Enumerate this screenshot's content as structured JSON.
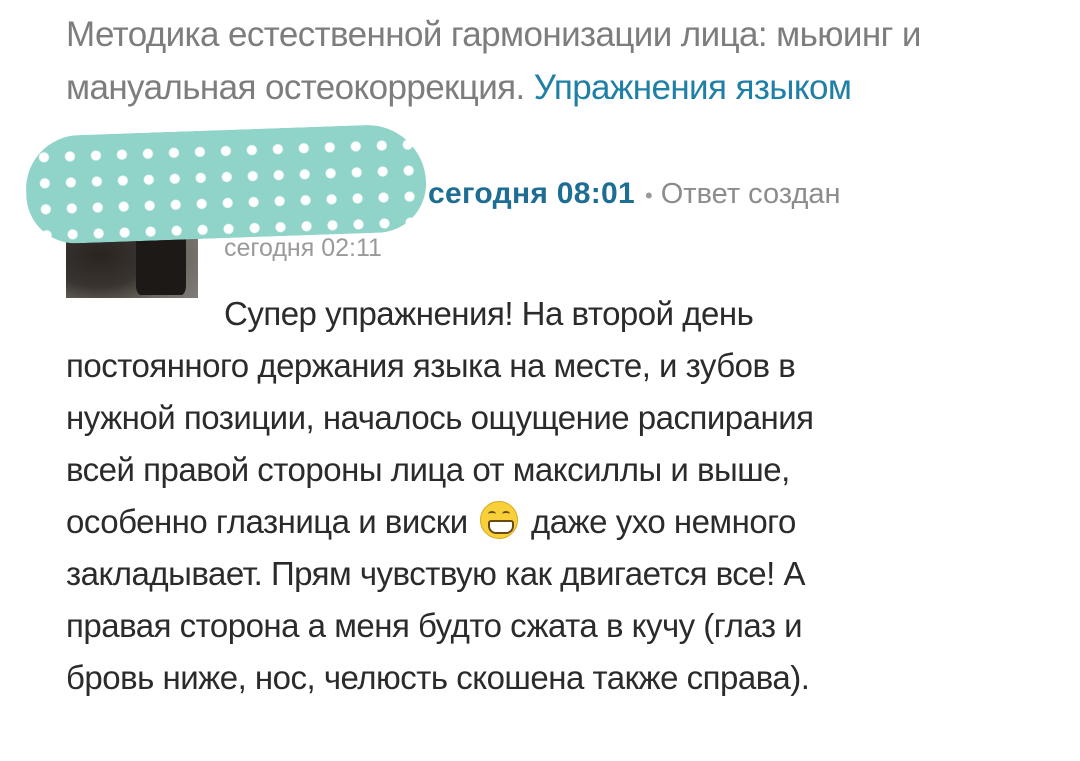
{
  "breadcrumb": {
    "parent_text": "Методика естественной гармонизации лица: мьюинг и мануальная остеокоррекция.",
    "current_link": "Упражнения языком"
  },
  "comment": {
    "author_avatar_icon": "user-avatar-redacted",
    "date_bold": "сегодня 08:01",
    "separator": "•",
    "created_label": "Ответ создан",
    "created_time": "сегодня 02:11",
    "first_line": "Супер упражнения! На второй день",
    "lines": [
      "постоянного держания языка на месте, и зубов в",
      "нужной позиции, началось ощущение распирания",
      "всей правой стороны лица от максиллы и выше,"
    ],
    "line_before_emoji": "особенно глазница и виски",
    "emoji_icon": "grinning-face-icon",
    "line_after_emoji": "даже ухо немного",
    "tail_lines": [
      "закладывает. Прям чувствую как двигается все! А",
      "правая сторона а меня будто сжата в кучу (глаз и",
      "бровь ниже, нос, челюсть скошена также справа)."
    ]
  },
  "colors": {
    "link": "#1f7fa6",
    "date": "#1e6e93",
    "muted": "#8c8c8c",
    "body_text": "#2b2b2b",
    "redaction": "#8fd3c9"
  }
}
